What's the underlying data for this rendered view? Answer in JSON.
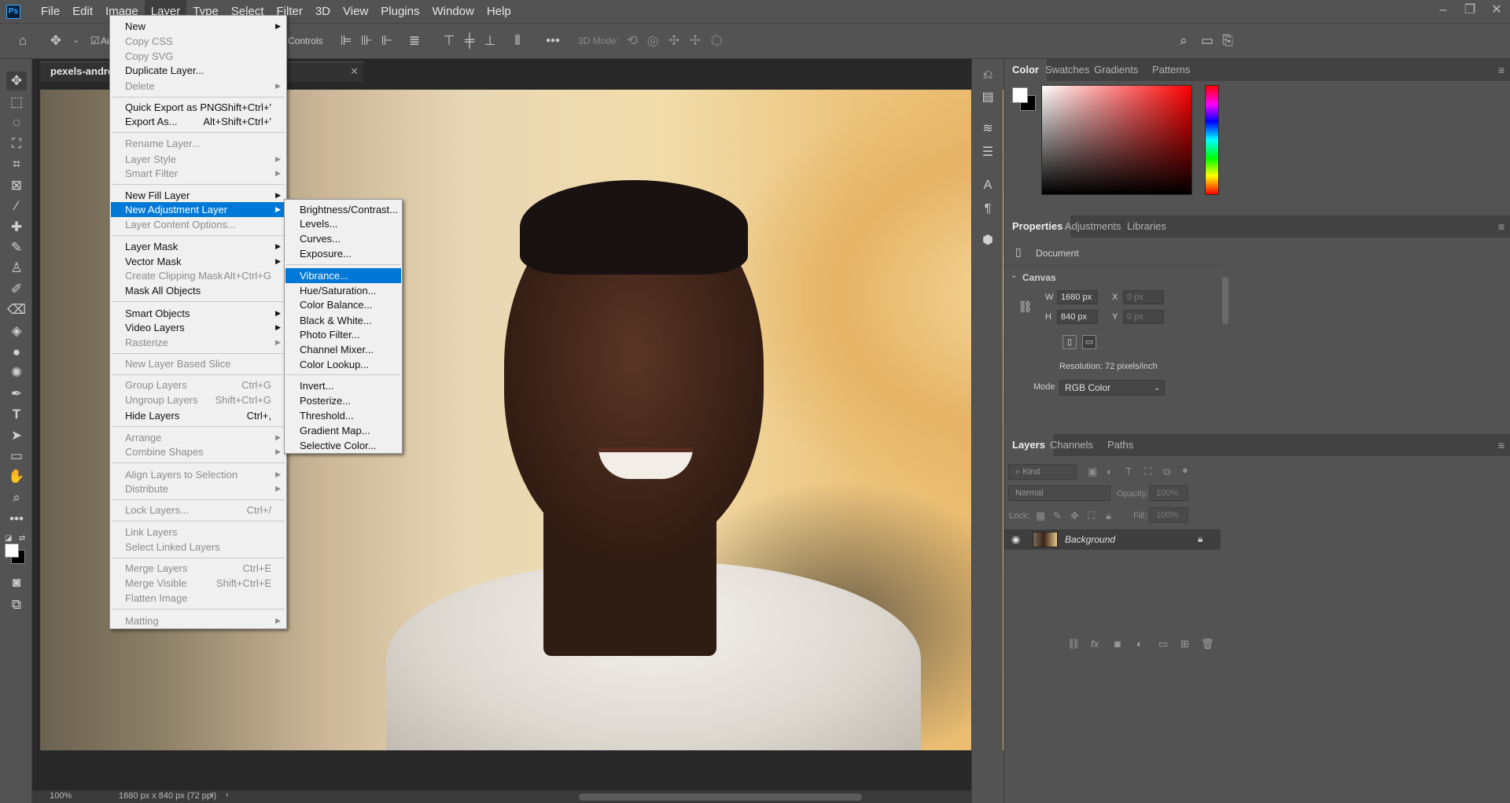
{
  "app": {
    "logo": "Ps"
  },
  "menubar": [
    "File",
    "Edit",
    "Image",
    "Layer",
    "Type",
    "Select",
    "Filter",
    "3D",
    "View",
    "Plugins",
    "Window",
    "Help"
  ],
  "window_controls": [
    "–",
    "❐",
    "✕"
  ],
  "options_bar": {
    "auto_label": "Au",
    "controls_label": "Controls",
    "mode3d_label": "3D Mode:"
  },
  "document": {
    "tab_title": "pexels-andrea-pi",
    "zoom": "100%",
    "info": "1680 px x 840 px (72 ppi)"
  },
  "layer_menu": {
    "items": [
      {
        "label": "New",
        "enabled": true,
        "submenu": true
      },
      {
        "label": "Copy CSS",
        "enabled": false
      },
      {
        "label": "Copy SVG",
        "enabled": false
      },
      {
        "label": "Duplicate Layer...",
        "enabled": true
      },
      {
        "label": "Delete",
        "enabled": false,
        "submenu": true
      },
      {
        "label": "Quick Export as PNG",
        "enabled": true,
        "shortcut": "Shift+Ctrl+'"
      },
      {
        "label": "Export As...",
        "enabled": true,
        "shortcut": "Alt+Shift+Ctrl+'"
      },
      {
        "label": "Rename Layer...",
        "enabled": false
      },
      {
        "label": "Layer Style",
        "enabled": false,
        "submenu": true
      },
      {
        "label": "Smart Filter",
        "enabled": false,
        "submenu": true
      },
      {
        "label": "New Fill Layer",
        "enabled": true,
        "submenu": true
      },
      {
        "label": "New Adjustment Layer",
        "enabled": true,
        "submenu": true,
        "highlighted": true
      },
      {
        "label": "Layer Content Options...",
        "enabled": false
      },
      {
        "label": "Layer Mask",
        "enabled": true,
        "submenu": true
      },
      {
        "label": "Vector Mask",
        "enabled": true,
        "submenu": true
      },
      {
        "label": "Create Clipping Mask",
        "enabled": false,
        "shortcut": "Alt+Ctrl+G"
      },
      {
        "label": "Mask All Objects",
        "enabled": true
      },
      {
        "label": "Smart Objects",
        "enabled": true,
        "submenu": true
      },
      {
        "label": "Video Layers",
        "enabled": true,
        "submenu": true
      },
      {
        "label": "Rasterize",
        "enabled": false,
        "submenu": true
      },
      {
        "label": "New Layer Based Slice",
        "enabled": false
      },
      {
        "label": "Group Layers",
        "enabled": false,
        "shortcut": "Ctrl+G"
      },
      {
        "label": "Ungroup Layers",
        "enabled": false,
        "shortcut": "Shift+Ctrl+G"
      },
      {
        "label": "Hide Layers",
        "enabled": true,
        "shortcut": "Ctrl+,"
      },
      {
        "label": "Arrange",
        "enabled": false,
        "submenu": true
      },
      {
        "label": "Combine Shapes",
        "enabled": false,
        "submenu": true
      },
      {
        "label": "Align Layers to Selection",
        "enabled": false,
        "submenu": true
      },
      {
        "label": "Distribute",
        "enabled": false,
        "submenu": true
      },
      {
        "label": "Lock Layers...",
        "enabled": false,
        "shortcut": "Ctrl+/"
      },
      {
        "label": "Link Layers",
        "enabled": false
      },
      {
        "label": "Select Linked Layers",
        "enabled": false
      },
      {
        "label": "Merge Layers",
        "enabled": false,
        "shortcut": "Ctrl+E"
      },
      {
        "label": "Merge Visible",
        "enabled": false,
        "shortcut": "Shift+Ctrl+E"
      },
      {
        "label": "Flatten Image",
        "enabled": false
      },
      {
        "label": "Matting",
        "enabled": false,
        "submenu": true
      }
    ]
  },
  "adjustment_submenu": {
    "items": [
      {
        "label": "Brightness/Contrast..."
      },
      {
        "label": "Levels..."
      },
      {
        "label": "Curves..."
      },
      {
        "label": "Exposure..."
      },
      {
        "label": "Vibrance...",
        "highlighted": true
      },
      {
        "label": "Hue/Saturation..."
      },
      {
        "label": "Color Balance..."
      },
      {
        "label": "Black & White..."
      },
      {
        "label": "Photo Filter..."
      },
      {
        "label": "Channel Mixer..."
      },
      {
        "label": "Color Lookup..."
      },
      {
        "label": "Invert..."
      },
      {
        "label": "Posterize..."
      },
      {
        "label": "Threshold..."
      },
      {
        "label": "Gradient Map..."
      },
      {
        "label": "Selective Color..."
      }
    ]
  },
  "color_panel": {
    "tabs": [
      "Color",
      "Swatches",
      "Gradients",
      "Patterns"
    ],
    "foreground": "#ffffff",
    "background": "#000000"
  },
  "properties_panel": {
    "tabs": [
      "Properties",
      "Adjustments",
      "Libraries"
    ],
    "section_doc": "Document",
    "section_canvas": "Canvas",
    "w_label": "W",
    "w_value": "1680 px",
    "h_label": "H",
    "h_value": "840 px",
    "x_label": "X",
    "x_placeholder": "0 px",
    "y_label": "Y",
    "y_placeholder": "0 px",
    "resolution": "Resolution: 72 pixels/inch",
    "mode_label": "Mode",
    "mode_value": "RGB Color"
  },
  "layers_panel": {
    "tabs": [
      "Layers",
      "Channels",
      "Paths"
    ],
    "filter_kind": "Kind",
    "blend_mode": "Normal",
    "opacity_label": "Opacity:",
    "opacity_value": "100%",
    "lock_label": "Lock:",
    "fill_label": "Fill:",
    "fill_value": "100%",
    "layer_name": "Background"
  }
}
